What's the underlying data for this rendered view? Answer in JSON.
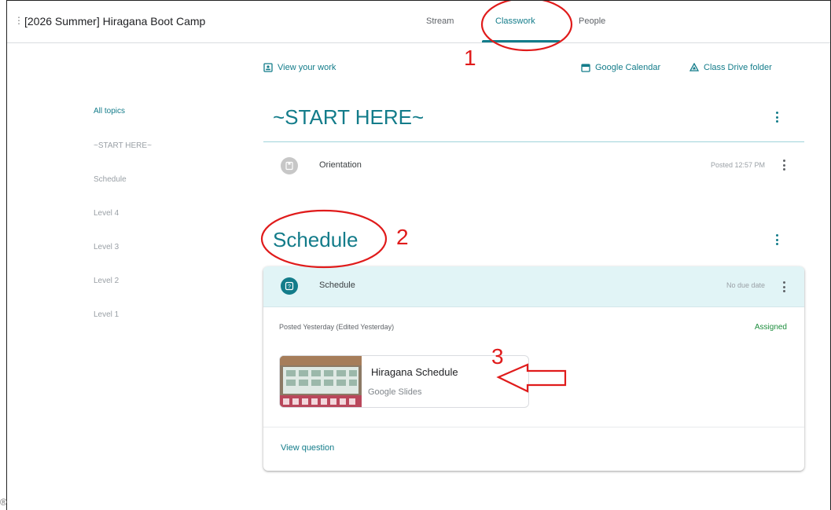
{
  "header": {
    "class_title": "[2026 Summer] Hiragana Boot Camp",
    "tabs": [
      "Stream",
      "Classwork",
      "People"
    ],
    "active_tab": "Classwork"
  },
  "toolbar": {
    "view_work": "View your work",
    "google_calendar": "Google Calendar",
    "class_drive": "Class Drive folder"
  },
  "sidebar": {
    "items": [
      {
        "label": "All topics",
        "active": true
      },
      {
        "label": "~START HERE~"
      },
      {
        "label": "Schedule"
      },
      {
        "label": "Level 4"
      },
      {
        "label": "Level 3"
      },
      {
        "label": "Level 2"
      },
      {
        "label": "Level 1"
      }
    ]
  },
  "topics": {
    "start": {
      "title": "~START HERE~",
      "item_label": "Orientation",
      "item_meta": "Posted 12:57 PM"
    },
    "schedule": {
      "title": "Schedule",
      "item_label": "Schedule",
      "item_meta": "No due date",
      "posted": "Posted Yesterday (Edited Yesterday)",
      "status": "Assigned",
      "attachment_title": "Hiragana Schedule",
      "attachment_type": "Google Slides",
      "view_link": "View question"
    }
  },
  "annotations": {
    "n1": "1",
    "n2": "2",
    "n3": "3"
  },
  "colors": {
    "accent": "#137c8a",
    "annotation": "#e01b1b",
    "assigned": "#1e8e3e",
    "card_header": "#e1f4f6"
  },
  "icons": {
    "view_work": "id-badge-icon",
    "calendar": "calendar-icon",
    "drive": "drive-icon",
    "orientation": "material-icon",
    "schedule": "question-icon",
    "more": "more-vert-icon"
  }
}
